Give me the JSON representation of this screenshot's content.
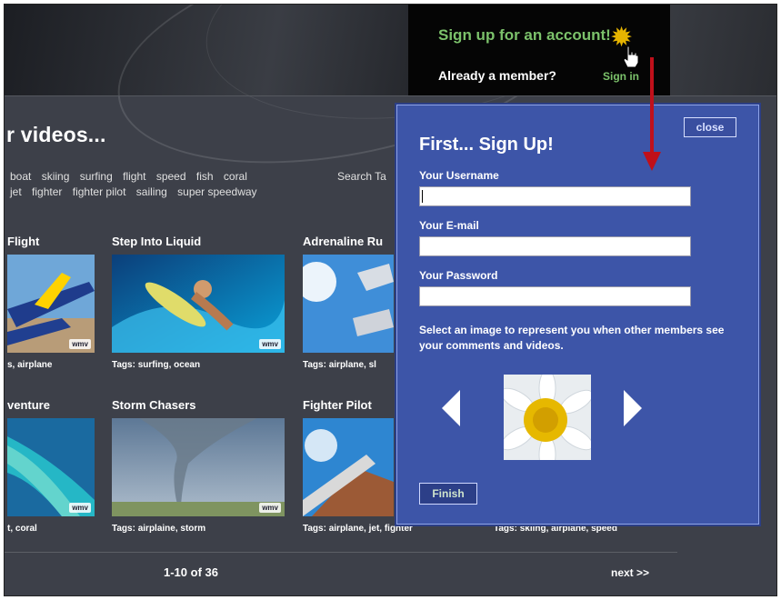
{
  "header": {
    "signup_link": "Sign up for an account!",
    "already_member": "Already a member?",
    "signin_link": "Sign in"
  },
  "section": {
    "title": "r videos..."
  },
  "tags": {
    "row1": [
      "boat",
      "skiing",
      "surfing",
      "flight",
      "speed",
      "fish",
      "coral"
    ],
    "row2": [
      "jet",
      "fighter",
      "fighter pilot",
      "sailing",
      "super speedway"
    ],
    "search_label": "Search Ta"
  },
  "videos": [
    {
      "title": "Flight",
      "tags": "s, airplane",
      "watermark": "wmv"
    },
    {
      "title": "Step Into Liquid",
      "tags": "Tags: surfing, ocean",
      "watermark": "wmv"
    },
    {
      "title": "Adrenaline Ru",
      "tags": "Tags: airplane, sl",
      "watermark": ""
    },
    {
      "title": "venture",
      "tags": "t, coral",
      "watermark": "wmv"
    },
    {
      "title": "Storm Chasers",
      "tags": "Tags: airplaine, storm",
      "watermark": "wmv"
    },
    {
      "title": "Fighter Pilot",
      "tags": "Tags: airplane, jet, fighter",
      "watermark": ""
    },
    {
      "title": "",
      "tags": "Tags: skiing, airplane, speed",
      "watermark": ""
    }
  ],
  "pager": {
    "range": "1-10 of 36",
    "next": "next >>"
  },
  "modal": {
    "title": "First... Sign Up!",
    "close": "close",
    "username_label": "Your Username",
    "username_value": "",
    "email_label": "Your E-mail",
    "email_value": "",
    "password_label": "Your Password",
    "password_value": "",
    "help": "Select an image to represent you when other members see your comments and videos.",
    "finish": "Finish"
  },
  "colors": {
    "accent_green": "#7cc26b",
    "modal_blue": "#3d55a8",
    "page_bg": "#3d4049",
    "annotation_red": "#c0101a"
  },
  "icons": [
    "hand-cursor-icon",
    "click-burst-icon",
    "left-arrow-icon",
    "right-arrow-icon",
    "red-arrow-icon"
  ]
}
